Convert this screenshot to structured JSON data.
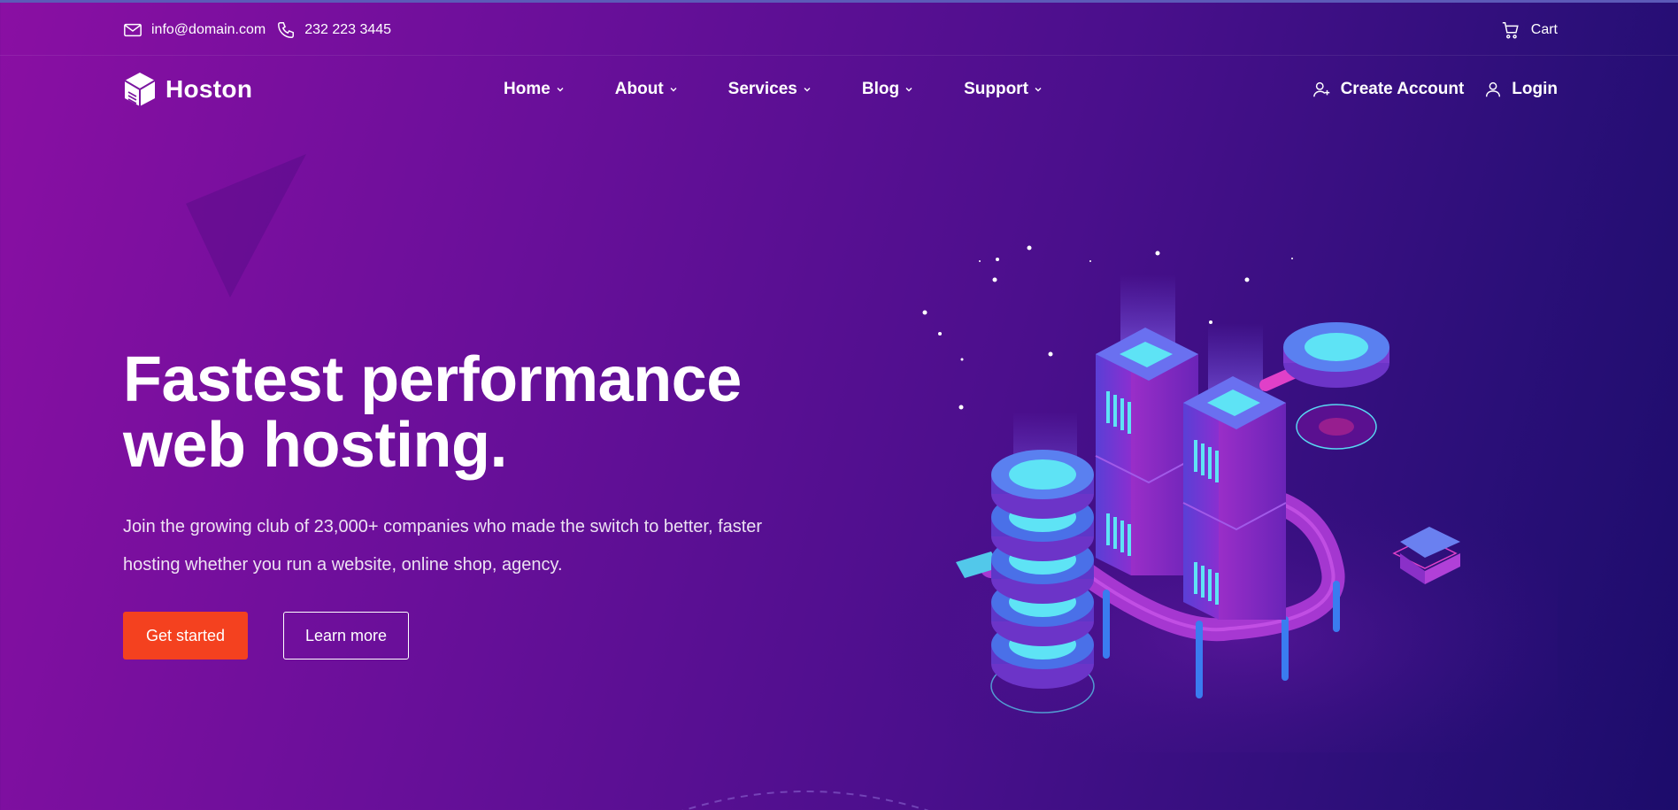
{
  "topbar": {
    "email": "info@domain.com",
    "phone": "232 223 3445",
    "cart_label": "Cart"
  },
  "brand": {
    "name": "Hoston"
  },
  "nav": {
    "items": [
      {
        "label": "Home"
      },
      {
        "label": "About"
      },
      {
        "label": "Services"
      },
      {
        "label": "Blog"
      },
      {
        "label": "Support"
      }
    ],
    "create_account": "Create Account",
    "login": "Login"
  },
  "hero": {
    "title": "Fastest performance web hosting.",
    "subtitle": "Join the growing club of 23,000+ companies who made the switch to better, faster hosting whether you run a website, online shop, agency.",
    "primary_button": "Get started",
    "secondary_button": "Learn more"
  },
  "colors": {
    "accent": "#f4411f",
    "gradient_start": "#8a0fa3",
    "gradient_end": "#1c0c6b",
    "glow": "#5ee3f5"
  },
  "icons": {
    "email": "envelope-icon",
    "phone": "phone-icon",
    "cart": "cart-icon",
    "create_account": "user-plus-icon",
    "login": "user-icon",
    "dropdown": "chevron-down-icon"
  }
}
